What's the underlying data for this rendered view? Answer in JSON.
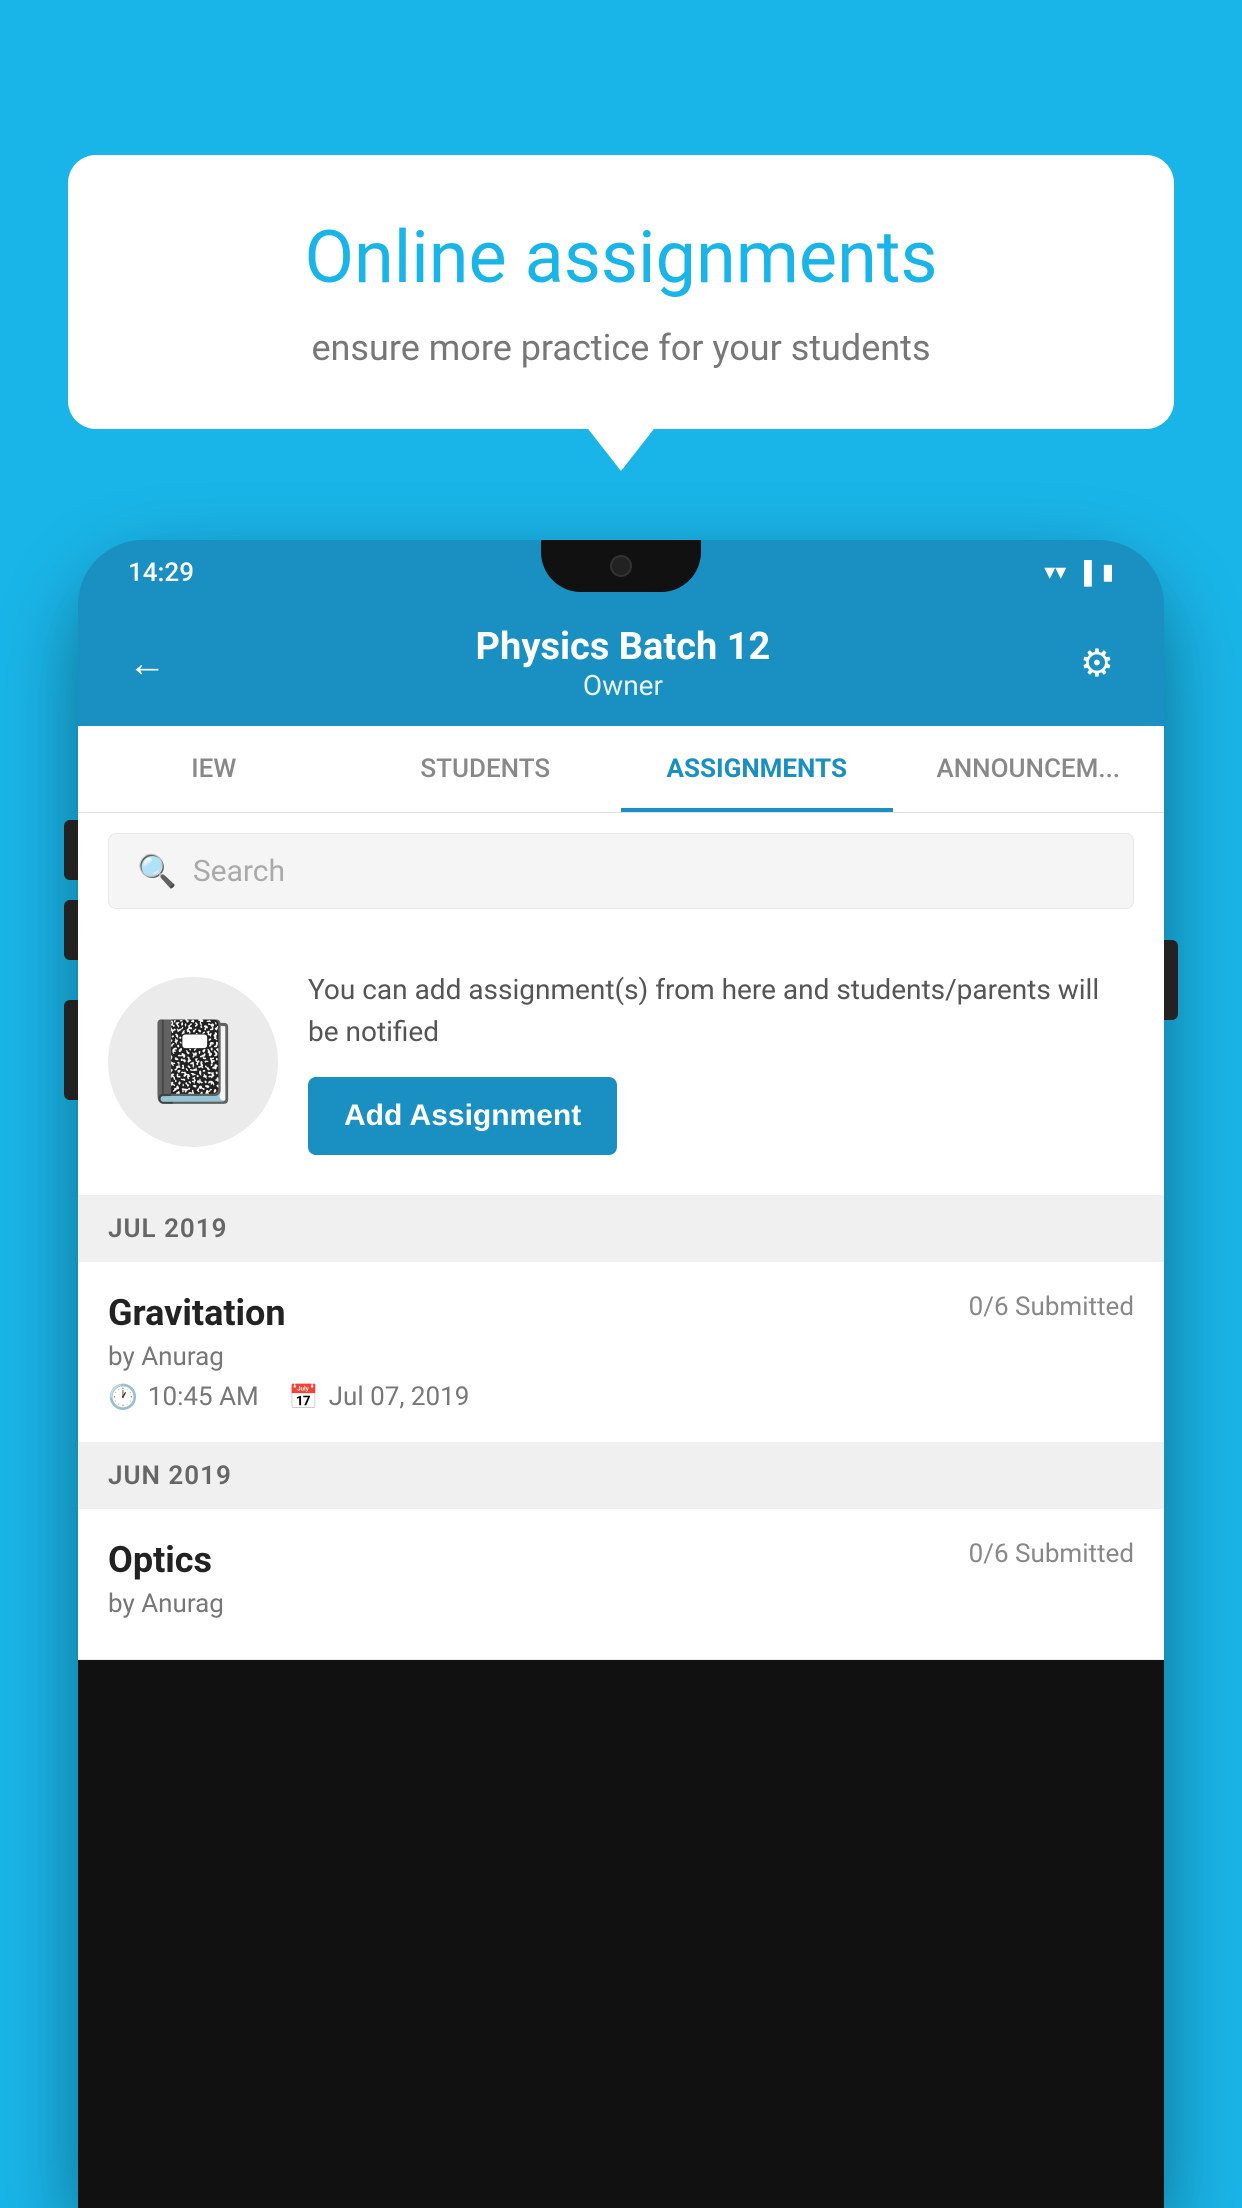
{
  "background_color": "#1ab5e8",
  "promo": {
    "title": "Online assignments",
    "subtitle": "ensure more practice for your students"
  },
  "phone": {
    "status_bar": {
      "time": "14:29",
      "icons": [
        "wifi",
        "signal",
        "battery"
      ]
    },
    "header": {
      "title": "Physics Batch 12",
      "subtitle": "Owner",
      "back_label": "←",
      "settings_label": "⚙"
    },
    "tabs": [
      {
        "label": "IEW",
        "active": false
      },
      {
        "label": "STUDENTS",
        "active": false
      },
      {
        "label": "ASSIGNMENTS",
        "active": true
      },
      {
        "label": "ANNOUNCEM...",
        "active": false
      }
    ],
    "search": {
      "placeholder": "Search",
      "icon": "🔍"
    },
    "assignment_promo": {
      "description": "You can add assignment(s) from here and students/parents will be notified",
      "button_label": "Add Assignment"
    },
    "sections": [
      {
        "month_label": "JUL 2019",
        "assignments": [
          {
            "name": "Gravitation",
            "submitted": "0/6 Submitted",
            "by": "by Anurag",
            "time": "10:45 AM",
            "date": "Jul 07, 2019"
          }
        ]
      },
      {
        "month_label": "JUN 2019",
        "assignments": [
          {
            "name": "Optics",
            "submitted": "0/6 Submitted",
            "by": "by Anurag",
            "time": "",
            "date": ""
          }
        ]
      }
    ]
  }
}
